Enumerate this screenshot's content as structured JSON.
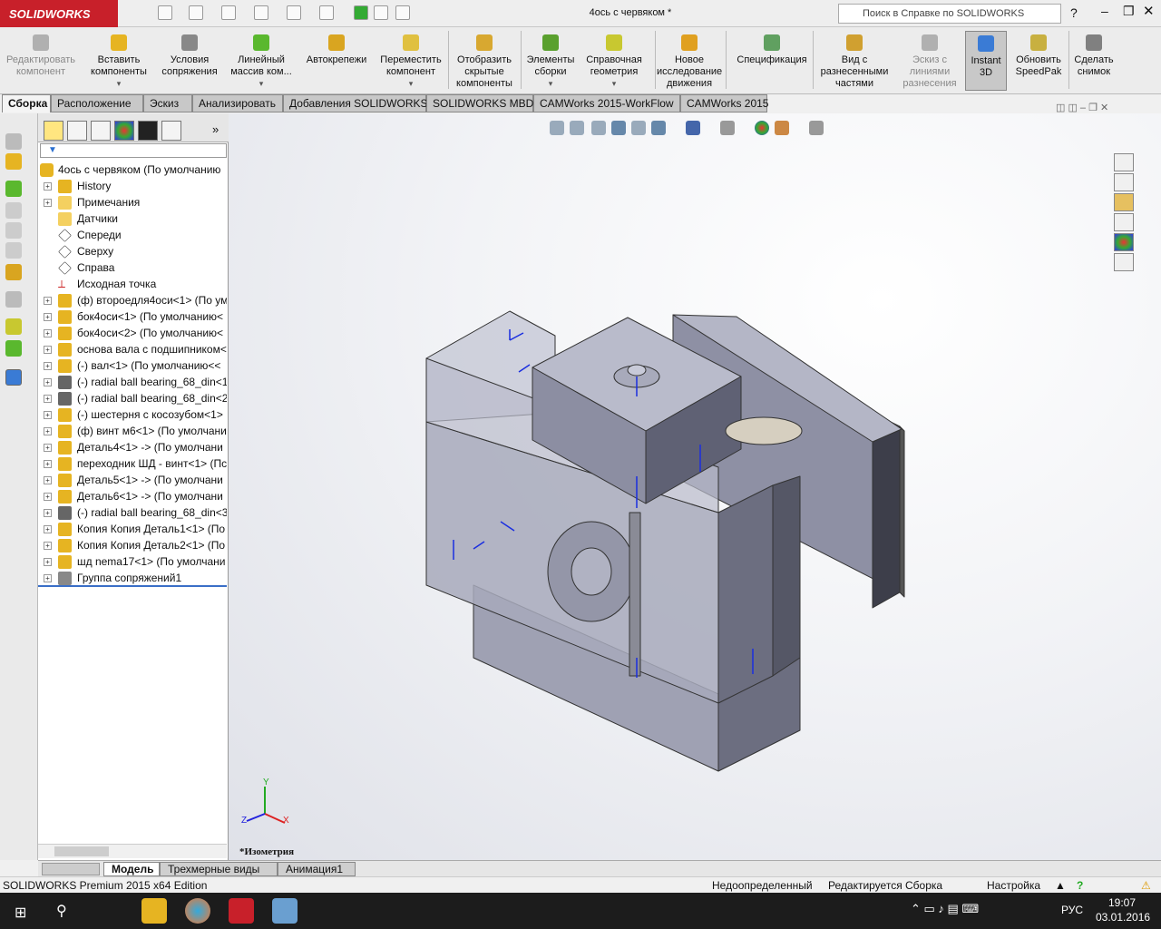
{
  "app": {
    "logo": "SOLIDWORKS",
    "title": "4ось с червяком *",
    "search_placeholder": "Поиск в Справке по SOLIDWORKS"
  },
  "ribbon": [
    {
      "label": "Редактировать компонент",
      "disabled": true,
      "color": "#b0b0b0"
    },
    {
      "label": "Вставить компоненты",
      "dropdown": true,
      "color": "#e6b422"
    },
    {
      "label": "Условия сопряжения",
      "color": "#888888"
    },
    {
      "label": "Линейный массив ком...",
      "dropdown": true,
      "color": "#5ab82e"
    },
    {
      "label": "Автокрепежи",
      "color": "#d9a520"
    },
    {
      "label": "Переместить компонент",
      "dropdown": true,
      "color": "#e0c040"
    },
    {
      "label": "Отобразить скрытые компоненты",
      "color": "#d8a830"
    },
    {
      "label": "Элементы сборки",
      "dropdown": true,
      "color": "#5aa02e"
    },
    {
      "label": "Справочная геометрия",
      "dropdown": true,
      "color": "#c8c830"
    },
    {
      "label": "Новое исследование движения",
      "color": "#e0a020"
    },
    {
      "label": "Спецификация",
      "color": "#60a060"
    },
    {
      "label": "Вид с разнесенными частями",
      "color": "#d0a030"
    },
    {
      "label": "Эскиз с линиями разнесения",
      "disabled": true,
      "color": "#b0b0b0"
    },
    {
      "label": "Instant 3D",
      "active": true,
      "color": "#3a7bd5"
    },
    {
      "label": "Обновить SpeedPak",
      "color": "#c8b040"
    },
    {
      "label": "Сделать снимок",
      "color": "#808080"
    }
  ],
  "tabs": [
    "Сборка",
    "Расположение",
    "Эскиз",
    "Анализировать",
    "Добавления SOLIDWORKS",
    "SOLIDWORKS MBD",
    "CAMWorks 2015-WorkFlow",
    "CAMWorks 2015"
  ],
  "tree": {
    "root": "4ось с червяком  (По умолчанию",
    "items": [
      {
        "label": "History",
        "icon": "history-icon",
        "expand": true
      },
      {
        "label": "Примечания",
        "icon": "annotations-icon",
        "expand": true
      },
      {
        "label": "Датчики",
        "icon": "sensors-icon",
        "expand": false
      },
      {
        "label": "Спереди",
        "icon": "plane-icon",
        "expand": false
      },
      {
        "label": "Сверху",
        "icon": "plane-icon",
        "expand": false
      },
      {
        "label": "Справа",
        "icon": "plane-icon",
        "expand": false
      },
      {
        "label": "Исходная точка",
        "icon": "origin-icon",
        "expand": false
      },
      {
        "label": "(ф) второедля4оси<1> (По ум",
        "icon": "part-icon",
        "expand": true
      },
      {
        "label": "бок4оси<1> (По умолчанию<",
        "icon": "part-icon",
        "expand": true
      },
      {
        "label": "бок4оси<2> (По умолчанию<",
        "icon": "part-icon",
        "expand": true
      },
      {
        "label": "основа вала с подшипником<",
        "icon": "part-icon",
        "expand": true
      },
      {
        "label": "(-) вал<1> (По умолчанию<<",
        "icon": "part-icon",
        "expand": true
      },
      {
        "label": "(-) radial ball bearing_68_din<1:",
        "icon": "toolbox-icon",
        "expand": true
      },
      {
        "label": "(-) radial ball bearing_68_din<2:",
        "icon": "toolbox-icon",
        "expand": true
      },
      {
        "label": "(-) шестерня с косозубом<1>",
        "icon": "part-icon",
        "expand": true
      },
      {
        "label": "(ф) винт м6<1> (По умолчани",
        "icon": "part-icon",
        "expand": true
      },
      {
        "label": "Деталь4<1> -> (По умолчани",
        "icon": "part-icon",
        "expand": true
      },
      {
        "label": "переходник ШД - винт<1> (Пс",
        "icon": "part-icon",
        "expand": true
      },
      {
        "label": "Деталь5<1> -> (По умолчани",
        "icon": "part-icon",
        "expand": true
      },
      {
        "label": "Деталь6<1> -> (По умолчани",
        "icon": "part-icon",
        "expand": true
      },
      {
        "label": "(-) radial ball bearing_68_din<3:",
        "icon": "toolbox-icon",
        "expand": true
      },
      {
        "label": "Копия Копия Деталь1<1> (По",
        "icon": "part-icon",
        "expand": true
      },
      {
        "label": "Копия Копия Деталь2<1> (По",
        "icon": "part-icon",
        "expand": true
      },
      {
        "label": "шд nema17<1> (По умолчани",
        "icon": "part-icon",
        "expand": true
      },
      {
        "label": "Группа сопряжений1",
        "icon": "mates-icon",
        "expand": true
      }
    ]
  },
  "viewport": {
    "view_name": "*Изометрия",
    "triad": {
      "x": "X",
      "y": "Y",
      "z": "Z"
    },
    "model_color": "#9a9cae"
  },
  "bottom_tabs": [
    "Модель",
    "Трехмерные виды",
    "Анимация1"
  ],
  "status": {
    "edition": "SOLIDWORKS Premium 2015 x64 Edition",
    "state": "Недоопределенный",
    "editing": "Редактируется Сборка",
    "custom": "Настройка"
  },
  "taskbar": {
    "lang": "РУС",
    "time": "19:07",
    "date": "03.01.2016"
  }
}
